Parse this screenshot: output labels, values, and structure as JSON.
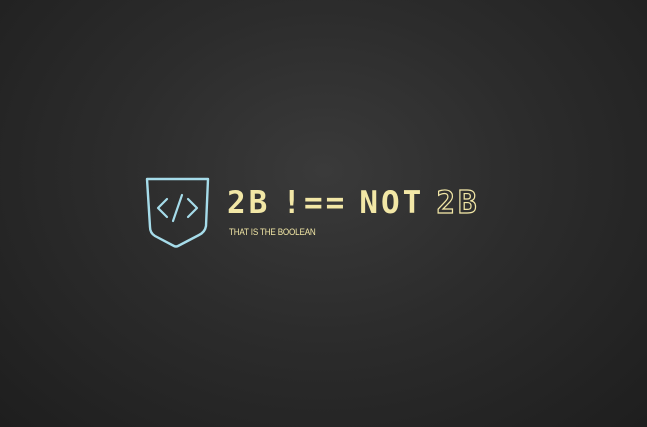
{
  "logo": {
    "icon": "code-shield-icon",
    "title_part1": "2B",
    "title_part2": "!==",
    "title_part3": "NOT",
    "title_part4": "2B",
    "tagline": "THAT IS THE BOOLEAN",
    "colors": {
      "text": "#f2e7a6",
      "icon": "#a6dcea",
      "background": "#2c2c2c"
    }
  }
}
